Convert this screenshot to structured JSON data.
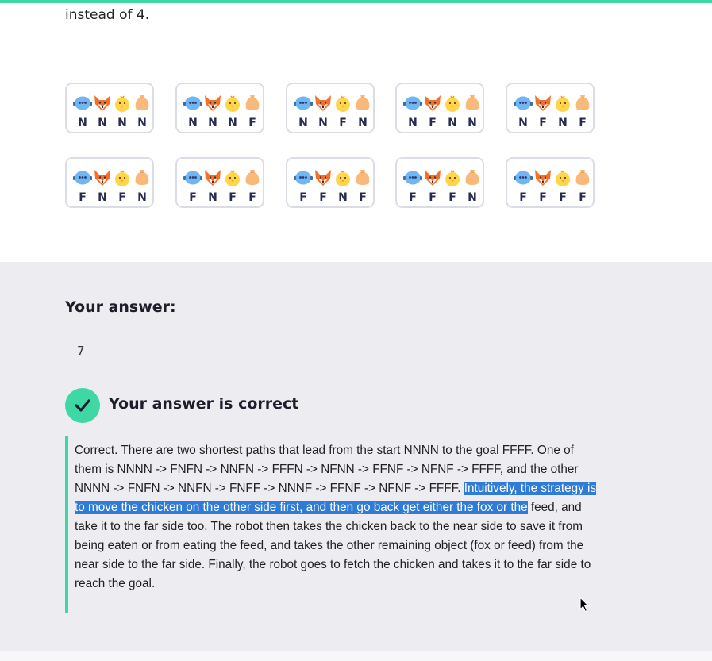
{
  "intro": {
    "tail_text": "instead of 4."
  },
  "colors": {
    "accent": "#3ed8a4",
    "highlight": "#2f7bd6",
    "answer_bg": "#ededf1",
    "tile_border": "#dcdce6"
  },
  "tile_icons": [
    "robot-icon",
    "fox-icon",
    "chicken-icon",
    "feed-sack-icon"
  ],
  "states": [
    [
      "N",
      "N",
      "N",
      "N"
    ],
    [
      "N",
      "N",
      "N",
      "F"
    ],
    [
      "N",
      "N",
      "F",
      "N"
    ],
    [
      "N",
      "F",
      "N",
      "N"
    ],
    [
      "N",
      "F",
      "N",
      "F"
    ],
    [
      "F",
      "N",
      "F",
      "N"
    ],
    [
      "F",
      "N",
      "F",
      "F"
    ],
    [
      "F",
      "F",
      "N",
      "F"
    ],
    [
      "F",
      "F",
      "F",
      "N"
    ],
    [
      "F",
      "F",
      "F",
      "F"
    ]
  ],
  "answer": {
    "label": "Your answer:",
    "value": "7",
    "status": "Your answer is correct",
    "explanation_before": "Correct. There are two shortest paths that lead from the start NNNN to the goal FFFF. One of them is NNNN -> FNFN -> NNFN -> FFFN -> NFNN -> FFNF -> NFNF -> FFFF, and the other NNNN -> FNFN -> NNFN -> FNFF -> NNNF -> FFNF -> NFNF -> FFFF. ",
    "explanation_highlight": "Intuitively, the strategy is to move the chicken on the other side first, and then go back get either the fox or the",
    "explanation_after": " feed, and take it to the far side too. The robot then takes the chicken back to the near side to save it from being eaten or from eating the feed, and takes the other remaining object (fox or feed) from the near side to the far side. Finally, the robot goes to fetch the chicken and takes it to the far side to reach the goal."
  }
}
